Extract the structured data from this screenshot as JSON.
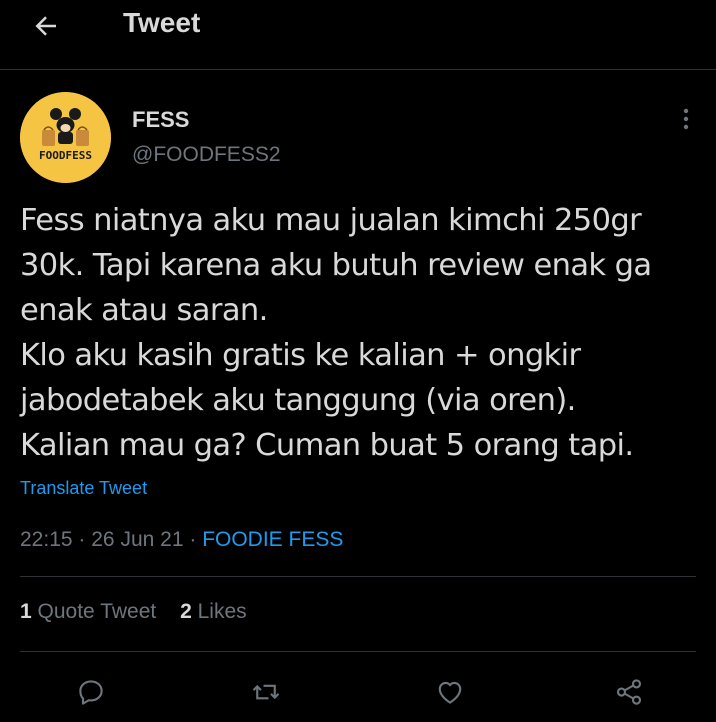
{
  "header": {
    "title": "Tweet",
    "back_icon": "arrow-left-icon"
  },
  "tweet": {
    "author": {
      "name": "FESS",
      "handle": "@FOODFESS2",
      "avatar_text": "FOODFESS",
      "avatar_color": "#f6c443"
    },
    "text": "Fess niatnya aku mau jualan kimchi 250gr\n30k. Tapi karena aku butuh review enak ga\nenak atau saran.\nKlo aku kasih gratis ke kalian + ongkir\njabodetabek aku tanggung  (via oren).\nKalian mau ga? Cuman buat 5 orang tapi.",
    "translate_label": "Translate Tweet",
    "time": "22:15",
    "date": "26 Jun 21",
    "separator": "·",
    "source": "FOODIE FESS",
    "stats": {
      "quote_count": "1",
      "quote_label": "Quote Tweet",
      "like_count": "2",
      "like_label": "Likes"
    }
  },
  "actions": [
    "reply-icon",
    "retweet-icon",
    "like-icon",
    "share-icon"
  ],
  "colors": {
    "background": "#000000",
    "text": "#d9d9d9",
    "secondary": "#6e767d",
    "accent": "#1d9bf0",
    "divider": "#2f3336"
  }
}
